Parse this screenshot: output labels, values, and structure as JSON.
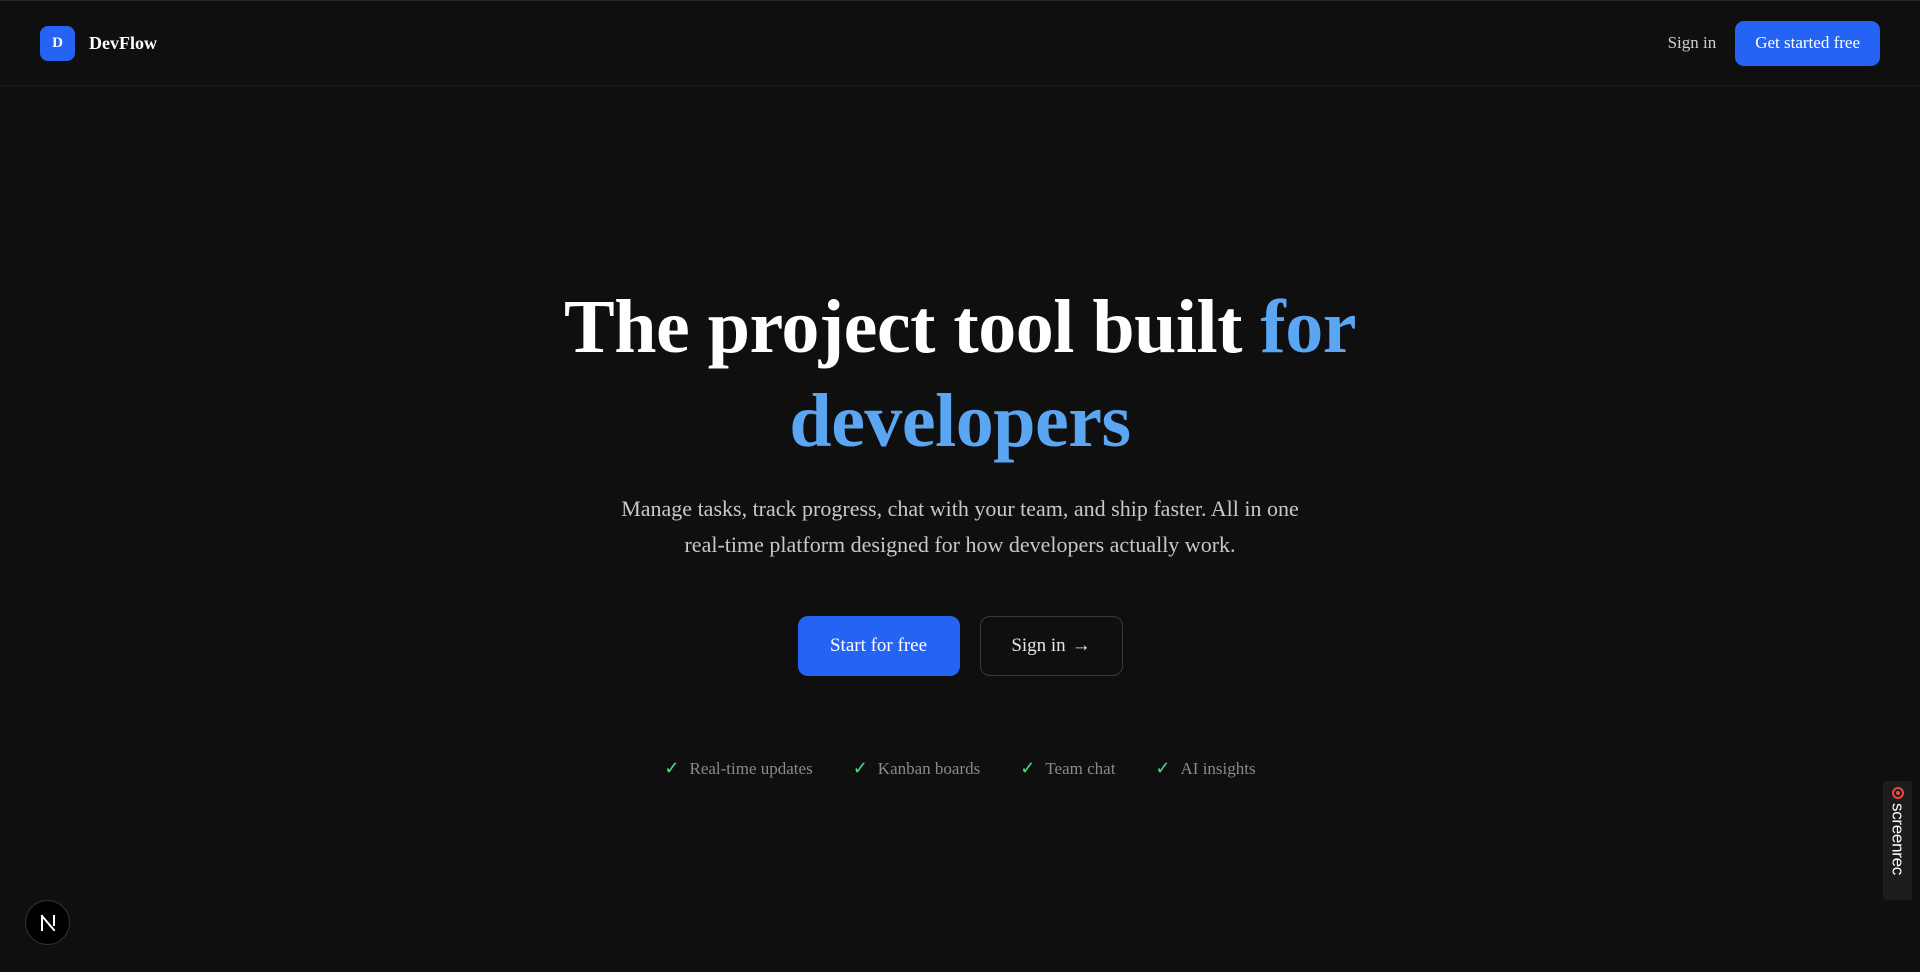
{
  "header": {
    "brand_initial": "D",
    "brand_name": "DevFlow",
    "signin_label": "Sign in",
    "get_started_label": "Get started free"
  },
  "hero": {
    "title_plain": "The project tool built ",
    "title_accent_1": "for",
    "title_accent_2": "developers",
    "subtitle_line1": "Manage tasks, track progress, chat with your team, and ship faster. All in one",
    "subtitle_line2": "real-time platform designed for how developers actually work.",
    "cta_primary": "Start for free",
    "cta_secondary": "Sign in",
    "cta_secondary_arrow": "→"
  },
  "features": [
    {
      "check": "✓",
      "label": "Real-time updates"
    },
    {
      "check": "✓",
      "label": "Kanban boards"
    },
    {
      "check": "✓",
      "label": "Team chat"
    },
    {
      "check": "✓",
      "label": "AI insights"
    }
  ],
  "overlays": {
    "next_badge_letter": "N",
    "screenrec_label": "screenrec"
  },
  "colors": {
    "background": "#0f0f0f",
    "brand_blue": "#2563f5",
    "accent_text": "#5aa6f2",
    "check_green": "#4ade80",
    "recording_red": "#ef4444"
  },
  "icons": {
    "check": "check-icon",
    "arrow": "arrow-right-icon",
    "recording": "record-icon"
  }
}
